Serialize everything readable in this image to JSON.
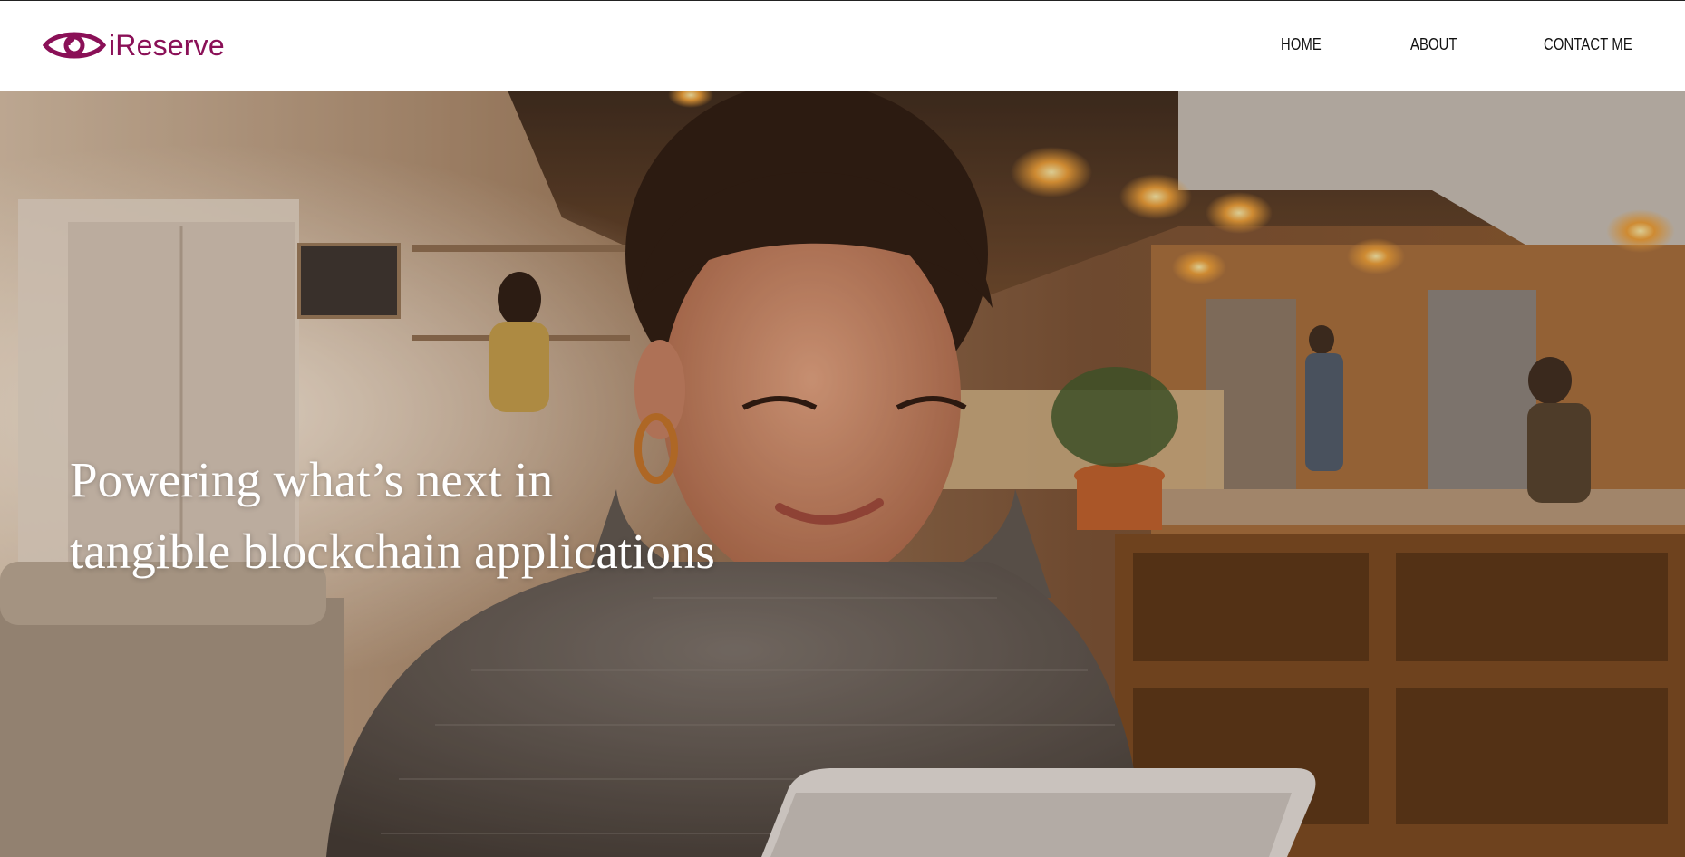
{
  "brand": {
    "name": "iReserve",
    "color": "#8a1057",
    "icon": "eye-icon"
  },
  "nav": {
    "items": [
      {
        "label": "HOME"
      },
      {
        "label": "ABOUT"
      },
      {
        "label": "CONTACT ME"
      }
    ]
  },
  "hero": {
    "title_line_1": "Powering what’s next in",
    "title_line_2": "tangible blockchain applications",
    "image_subject": "woman-using-tablet-in-cafe"
  }
}
